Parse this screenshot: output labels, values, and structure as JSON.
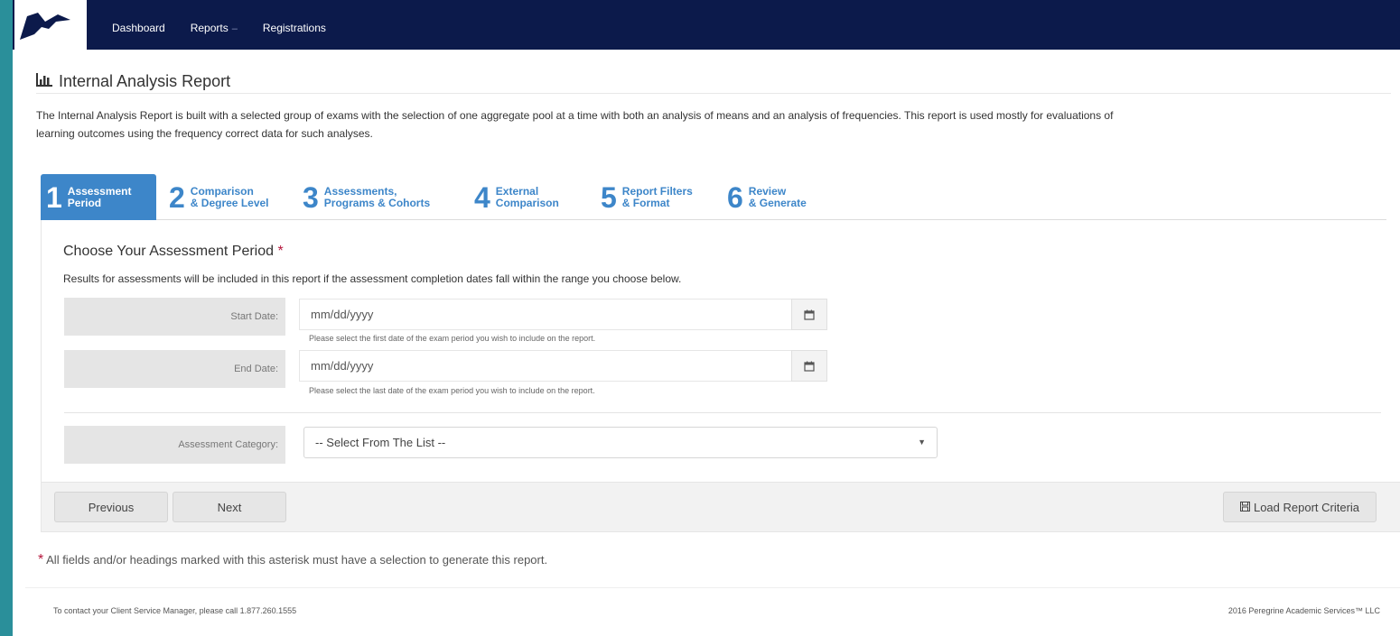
{
  "nav": {
    "items": [
      {
        "label": "Dashboard"
      },
      {
        "label": "Reports",
        "caret": "–"
      },
      {
        "label": "Registrations"
      }
    ]
  },
  "page": {
    "title": "Internal Analysis Report",
    "description": "The Internal Analysis Report is built with a selected group of exams with the selection of one aggregate pool at a time with both an analysis of means and an analysis of frequencies. This report is used mostly for evaluations of learning outcomes using the frequency correct data for such analyses."
  },
  "steps": [
    {
      "num": "1",
      "line1": "Assessment",
      "line2": "Period",
      "active": true
    },
    {
      "num": "2",
      "line1": "Comparison",
      "line2": "& Degree Level",
      "active": false
    },
    {
      "num": "3",
      "line1": "Assessments,",
      "line2": "Programs & Cohorts",
      "active": false
    },
    {
      "num": "4",
      "line1": "External",
      "line2": "Comparison",
      "active": false
    },
    {
      "num": "5",
      "line1": "Report Filters",
      "line2": "& Format",
      "active": false
    },
    {
      "num": "6",
      "line1": "Review",
      "line2": "& Generate",
      "active": false
    }
  ],
  "form": {
    "heading": "Choose Your Assessment Period",
    "asterisk": "*",
    "description": "Results for assessments will be included in this report if the assessment completion dates fall within the range you choose below.",
    "start_date": {
      "label": "Start Date:",
      "placeholder": "mm/dd/yyyy",
      "help": "Please select the first date of the exam period you wish to include on the report."
    },
    "end_date": {
      "label": "End Date:",
      "placeholder": "mm/dd/yyyy",
      "help": "Please select the last date of the exam period you wish to include on the report."
    },
    "category": {
      "label": "Assessment Category:",
      "selected": "-- Select From The List --"
    }
  },
  "buttons": {
    "previous": "Previous",
    "next": "Next",
    "load": "Load Report Criteria"
  },
  "required_note": "All fields and/or headings marked with this asterisk must have a selection to generate this report.",
  "footer": {
    "contact": "To contact your Client Service Manager, please call 1.877.260.1555",
    "copyright": "2016 Peregrine Academic Services™ LLC"
  },
  "colors": {
    "navbar": "#0c1a4b",
    "accent": "#3d86c9",
    "required": "#b5153b",
    "frame": "#2a8f9a"
  }
}
